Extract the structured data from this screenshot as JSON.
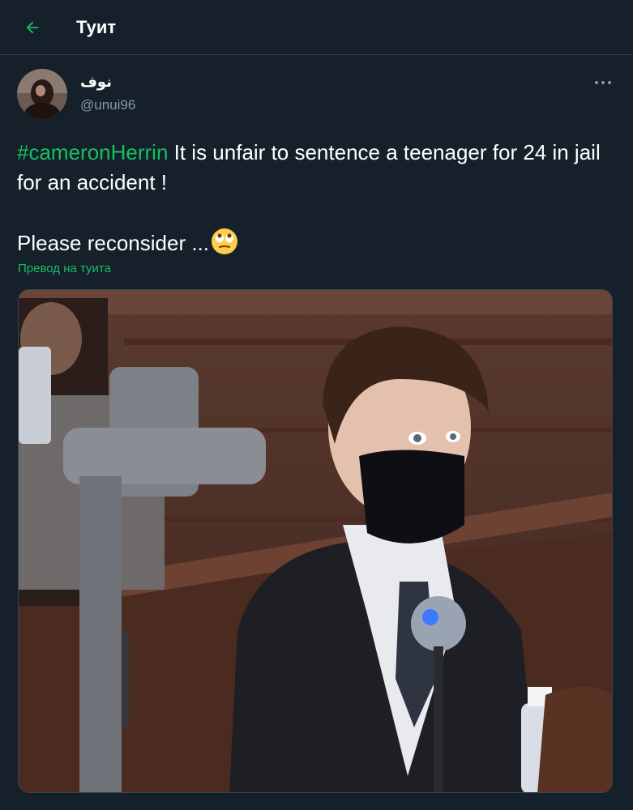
{
  "header": {
    "title": "Туит",
    "back_icon": "arrow-left-icon",
    "accent_color": "#17bf63"
  },
  "tweet": {
    "author": {
      "display_name": "نوف",
      "handle": "@unui96"
    },
    "more_icon": "more-horizontal-icon",
    "text": {
      "hashtag": "#cameronHerrin",
      "line1": " It is unfair to sentence a teenager for 24 in jail for an accident !",
      "line2": "Please reconsider ...",
      "emoji": "face-with-rolling-eyes"
    },
    "translate_label": "Превод на туита",
    "media": {
      "type": "photo",
      "subject": "courtroom photo"
    }
  },
  "colors": {
    "background": "#15202b",
    "divider": "#38444d",
    "secondary_text": "#8899a6",
    "link": "#17bf63"
  }
}
